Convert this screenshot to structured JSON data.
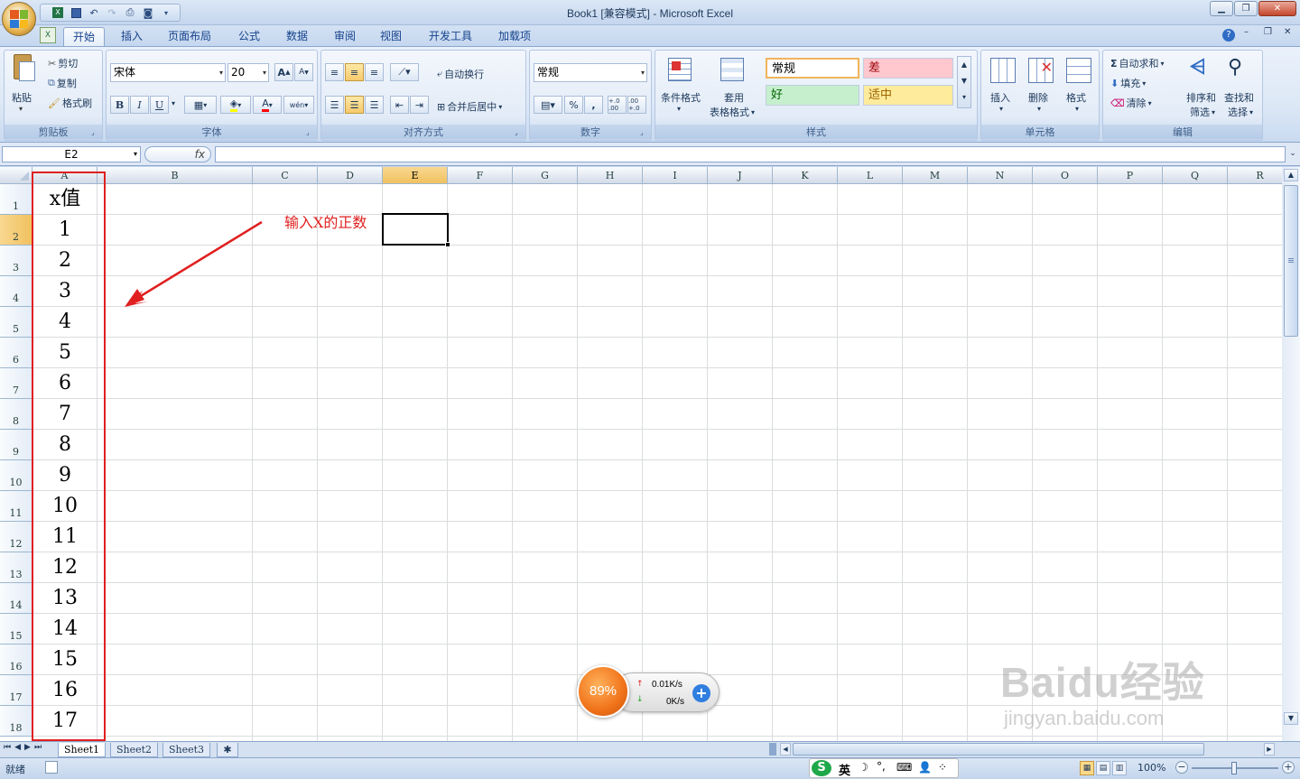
{
  "window": {
    "title": "Book1  [兼容模式] - Microsoft Excel"
  },
  "tabs": [
    "开始",
    "插入",
    "页面布局",
    "公式",
    "数据",
    "审阅",
    "视图",
    "开发工具",
    "加载项"
  ],
  "ribbon": {
    "clipboard": {
      "label": "剪贴板",
      "paste": "粘贴",
      "cut": "剪切",
      "copy": "复制",
      "format_painter": "格式刷"
    },
    "font": {
      "label": "字体",
      "font_name": "宋体",
      "font_size": "20",
      "bold": "B",
      "italic": "I",
      "underline": "U",
      "grow": "A",
      "shrink": "A",
      "font_color": "A",
      "phonetic": "wén"
    },
    "alignment": {
      "label": "对齐方式",
      "wrap": "自动换行",
      "merge": "合并后居中"
    },
    "number": {
      "label": "数字",
      "format": "常规",
      "percent": "%",
      "comma": ",",
      "inc_dec": "+.0 .00",
      "dec_dec": ".00 +.0"
    },
    "styles": {
      "label": "样式",
      "conditional": "条件格式",
      "table_format_1": "套用",
      "table_format_2": "表格格式",
      "normal": "常规",
      "bad": "差",
      "good": "好",
      "neutral": "适中"
    },
    "cells": {
      "label": "单元格",
      "insert": "插入",
      "delete": "删除",
      "format": "格式"
    },
    "editing": {
      "label": "编辑",
      "autosum": "自动求和",
      "fill": "填充",
      "clear": "清除",
      "sort_1": "排序和",
      "sort_2": "筛选",
      "find_1": "查找和",
      "find_2": "选择"
    }
  },
  "formula_bar": {
    "name_box": "E2",
    "fx": "fx",
    "content": ""
  },
  "columns": [
    "A",
    "B",
    "C",
    "D",
    "E",
    "F",
    "G",
    "H",
    "I",
    "J",
    "K",
    "L",
    "M",
    "N",
    "O",
    "P",
    "Q",
    "R"
  ],
  "rows": [
    "1",
    "2",
    "3",
    "4",
    "5",
    "6",
    "7",
    "8",
    "9",
    "10",
    "11",
    "12",
    "13",
    "14",
    "15",
    "16",
    "17",
    "18"
  ],
  "selected_cell": "E2",
  "cells_A": [
    "x值",
    "1",
    "2",
    "3",
    "4",
    "5",
    "6",
    "7",
    "8",
    "9",
    "10",
    "11",
    "12",
    "13",
    "14",
    "15",
    "16",
    "17"
  ],
  "annotation": {
    "text": "输入X的正数",
    "color": "#e02020"
  },
  "sheets": [
    "Sheet1",
    "Sheet2",
    "Sheet3"
  ],
  "active_sheet": "Sheet1",
  "status": {
    "ready": "就绪",
    "zoom": "100%"
  },
  "net_widget": {
    "percent": "89%",
    "up": "0.01K/s",
    "down": "0K/s"
  },
  "ime": {
    "lang": "英"
  },
  "watermark": {
    "line1": "Baidu经验",
    "line2": "jingyan.baidu.com"
  },
  "colors": {
    "accent": "#15428b",
    "selection_header": "#f1c15f",
    "red_box": "#e02020",
    "bad_fill": "#ffc7ce",
    "good_fill": "#c6efce",
    "neutral_fill": "#ffeb9c"
  }
}
